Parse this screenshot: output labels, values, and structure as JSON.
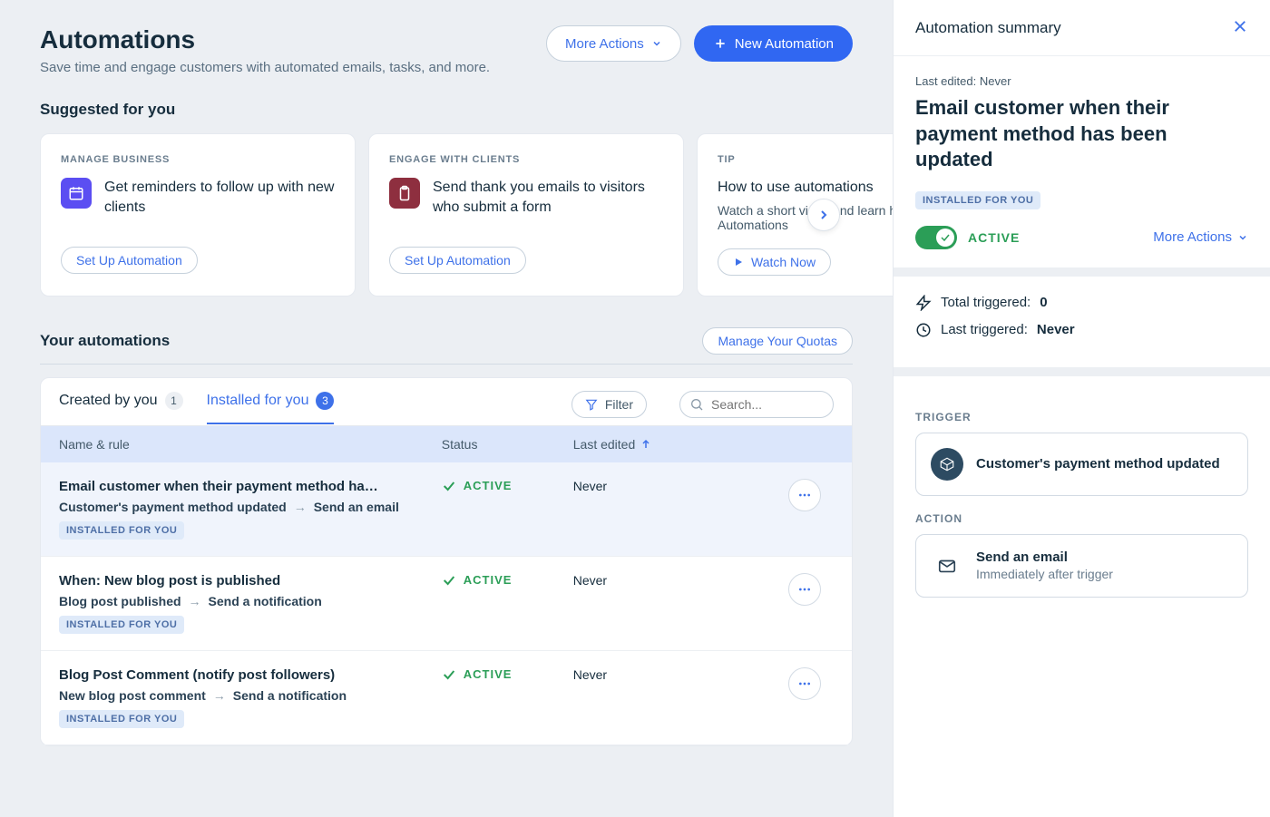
{
  "header": {
    "title": "Automations",
    "subtitle": "Save time and engage customers with automated emails, tasks, and more.",
    "more_actions": "More Actions",
    "new_automation": "New Automation"
  },
  "suggested": {
    "title": "Suggested for you",
    "cards": [
      {
        "category": "MANAGE BUSINESS",
        "title": "Get reminders to follow up with new clients",
        "cta": "Set Up Automation",
        "icon_color": "purple"
      },
      {
        "category": "ENGAGE WITH CLIENTS",
        "title": "Send thank you emails to visitors who submit a form",
        "cta": "Set Up Automation",
        "icon_color": "maroon"
      },
      {
        "category": "TIP",
        "title": "How to use automations",
        "desc": "Watch a short video and learn how to use Automations",
        "cta": "Watch Now"
      }
    ]
  },
  "your": {
    "title": "Your automations",
    "manage_quotas": "Manage Your Quotas"
  },
  "tabs": {
    "created_label": "Created by you",
    "created_count": "1",
    "installed_label": "Installed for you",
    "installed_count": "3",
    "filter": "Filter",
    "search_placeholder": "Search..."
  },
  "columns": {
    "name": "Name & rule",
    "status": "Status",
    "last_edited": "Last edited"
  },
  "status_labels": {
    "active": "ACTIVE"
  },
  "badges": {
    "installed": "INSTALLED FOR YOU"
  },
  "rows": [
    {
      "title": "Email customer when their payment method ha…",
      "trigger": "Customer's payment method updated",
      "action": "Send an email",
      "status": "ACTIVE",
      "last_edited": "Never",
      "installed": true,
      "selected": true
    },
    {
      "title": "When: New blog post is published",
      "trigger": "Blog post published",
      "action": "Send a notification",
      "status": "ACTIVE",
      "last_edited": "Never",
      "installed": true,
      "selected": false
    },
    {
      "title": "Blog Post Comment (notify post followers)",
      "trigger": "New blog post comment",
      "action": "Send a notification",
      "status": "ACTIVE",
      "last_edited": "Never",
      "installed": true,
      "selected": false
    }
  ],
  "panel": {
    "header": "Automation summary",
    "last_edited_label": "Last edited:",
    "last_edited_value": "Never",
    "title": "Email customer when their payment method has been updated",
    "installed_badge": "INSTALLED FOR YOU",
    "toggle_label": "ACTIVE",
    "more_actions": "More Actions",
    "total_triggered_label": "Total triggered:",
    "total_triggered_value": "0",
    "last_triggered_label": "Last triggered:",
    "last_triggered_value": "Never",
    "trigger_section": "TRIGGER",
    "trigger_title": "Customer's payment method updated",
    "action_section": "ACTION",
    "action_title": "Send an email",
    "action_sub": "Immediately after trigger"
  }
}
